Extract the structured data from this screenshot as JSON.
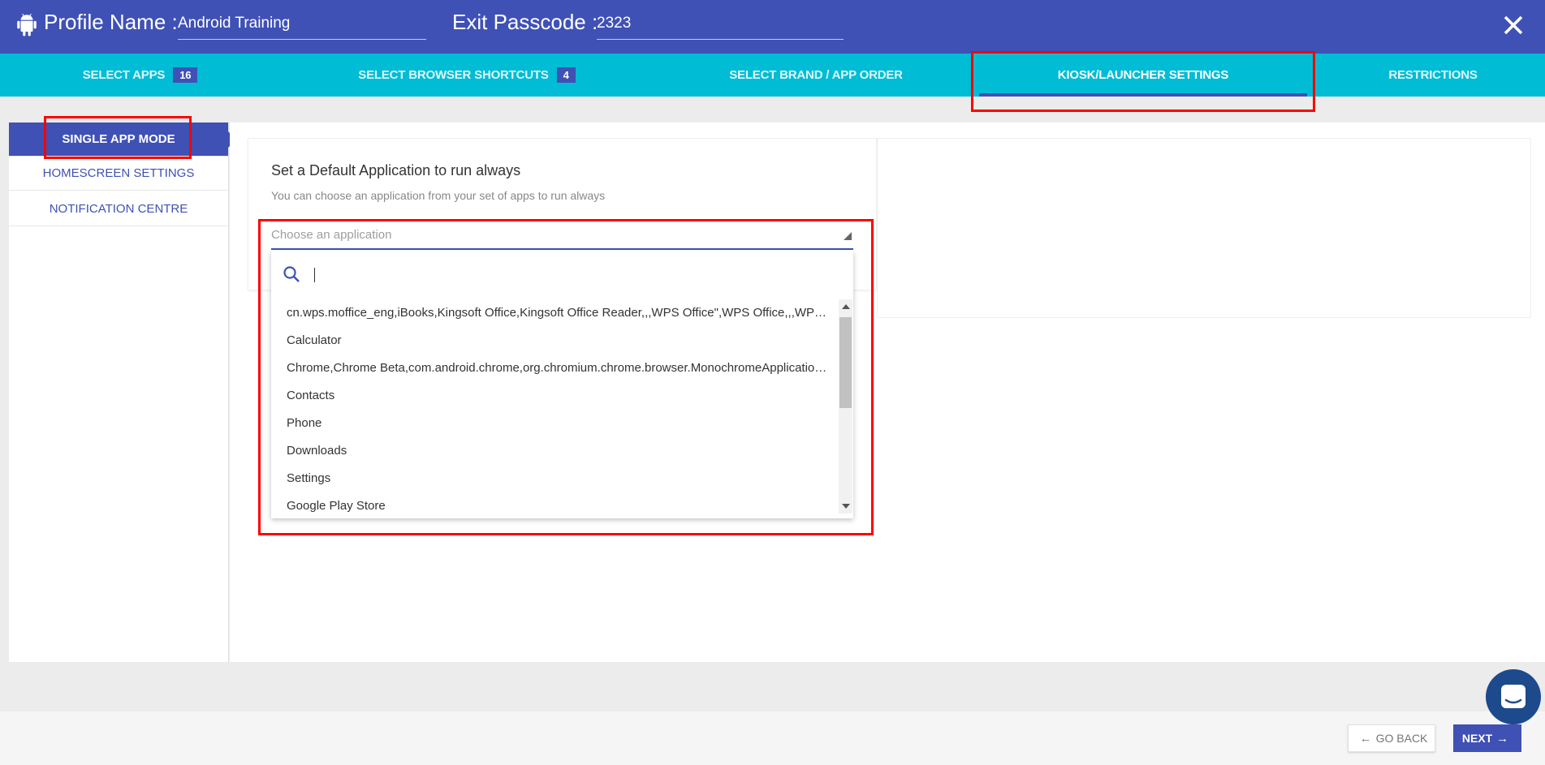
{
  "header": {
    "profile_name_label": "Profile Name :",
    "profile_name_value": "Android Training",
    "exit_passcode_label": "Exit Passcode :",
    "exit_passcode_value": "2323"
  },
  "tabs": [
    {
      "label": "SELECT APPS",
      "badge": "16"
    },
    {
      "label": "SELECT BROWSER SHORTCUTS",
      "badge": "4"
    },
    {
      "label": "SELECT BRAND / APP ORDER"
    },
    {
      "label": "KIOSK/LAUNCHER SETTINGS",
      "active": true
    },
    {
      "label": "RESTRICTIONS"
    }
  ],
  "sidebar": {
    "items": [
      {
        "label": "SINGLE APP MODE",
        "active": true
      },
      {
        "label": "HOMESCREEN SETTINGS"
      },
      {
        "label": "NOTIFICATION CENTRE"
      }
    ]
  },
  "main": {
    "title": "Set a Default Application to run always",
    "subtitle": "You can choose an application from your set of apps to run always",
    "select_placeholder": "Choose an application",
    "search_value": "",
    "options": [
      "cn.wps.moffice_eng,iBooks,Kingsoft Office,Kingsoft Office Reader,,,WPS Office\",WPS Office,,,WPS O...",
      "Calculator",
      "Chrome,Chrome Beta,com.android.chrome,org.chromium.chrome.browser.MonochromeApplication,...",
      "Contacts",
      "Phone",
      "Downloads",
      "Settings",
      "Google Play Store"
    ]
  },
  "footer": {
    "back_label": "GO BACK",
    "next_label": "NEXT"
  },
  "colors": {
    "primary": "#3f51b5",
    "tab_bar": "#00bcd4",
    "highlight": "#ff0000"
  }
}
